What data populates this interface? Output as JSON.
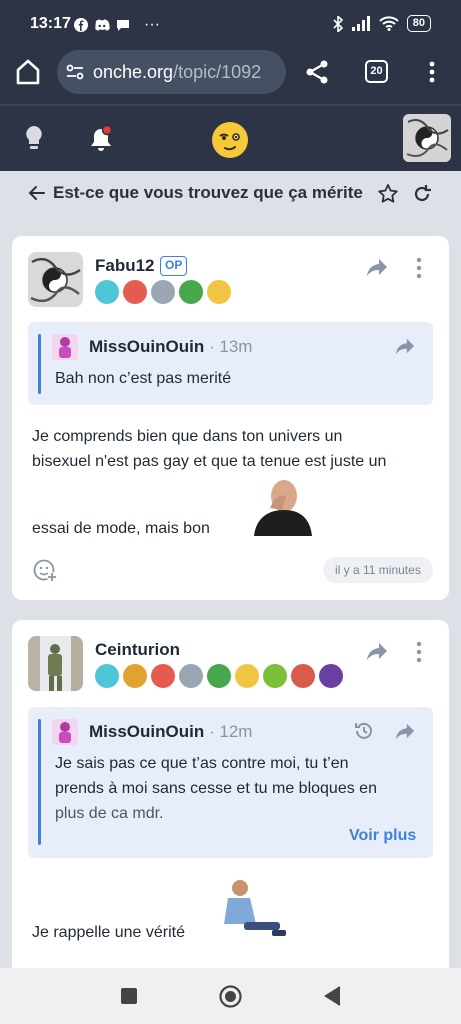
{
  "status_bar": {
    "time": "13:17",
    "dots": "···",
    "battery": "80"
  },
  "browser": {
    "url_host": "onche.org",
    "url_path": "/topic/1092",
    "tab_count": "20"
  },
  "topic": {
    "title": "Est-ce que vous trouvez que ça mérite l"
  },
  "posts": [
    {
      "author": "Fabu12",
      "op_badge": "OP",
      "quote": {
        "author": "MissOuinOuin",
        "time": "13m",
        "separator": "·",
        "text": "Bah non c’est pas merité"
      },
      "body_line1": "Je comprends bien que dans ton univers un",
      "body_line2": "bisexuel n'est pas gay et que ta tenue est juste un",
      "body_line3": "essai de mode, mais bon",
      "time_ago": "il y a 11 minutes"
    },
    {
      "author": "Ceinturion",
      "quote": {
        "author": "MissOuinOuin",
        "time": "12m",
        "separator": "·",
        "line1": "Je sais pas ce que t’as contre moi, tu t’en",
        "line2": "prends à moi sans cesse et tu me bloques en",
        "line3": "plus de ca mdr.",
        "more": "Voir plus"
      },
      "body": "Je rappelle une vérité"
    }
  ],
  "colors": {
    "header": "#2c3445",
    "accent": "#3d82d6",
    "quote_bg": "#e8eef9",
    "page_bg": "#dde0e6"
  }
}
